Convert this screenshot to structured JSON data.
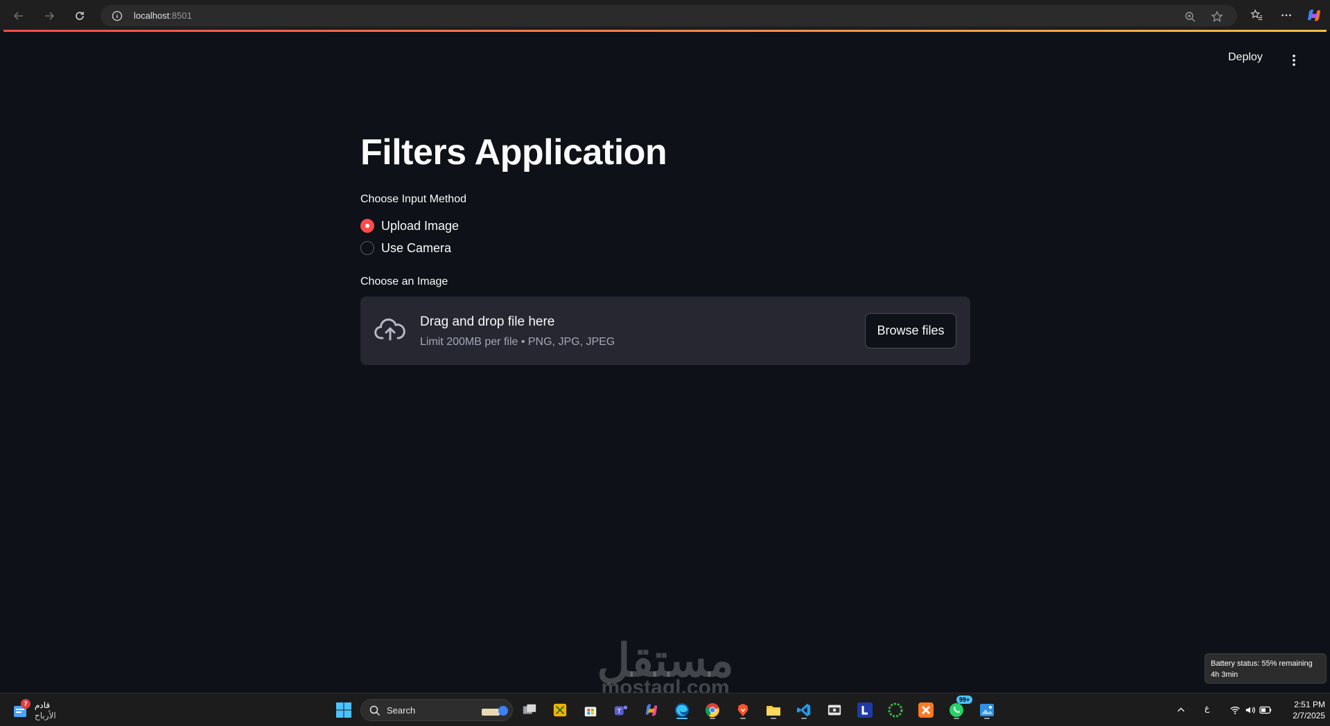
{
  "browser": {
    "url_host": "localhost",
    "url_port": ":8501"
  },
  "header": {
    "deploy_label": "Deploy"
  },
  "main": {
    "title": "Filters Application",
    "input_method_label": "Choose Input Method",
    "radio_options": [
      {
        "label": "Upload Image",
        "selected": true
      },
      {
        "label": "Use Camera",
        "selected": false
      }
    ],
    "uploader": {
      "label": "Choose an Image",
      "drop_text": "Drag and drop file here",
      "limit_text": "Limit 200MB per file • PNG, JPG, JPEG",
      "browse_label": "Browse files"
    }
  },
  "watermark": {
    "arabic": "مستقل",
    "latin": "mostaql.com"
  },
  "tooltip": {
    "battery_line1": "Battery status: 55% remaining",
    "battery_line2": "4h 3min"
  },
  "taskbar": {
    "weather_badge": "7",
    "weather_line1": "قادم",
    "weather_line2": "الأرباح",
    "search_placeholder": "Search",
    "whatsapp_badge": "99+",
    "lang_indicator": "ع",
    "time": "2:51 PM",
    "date": "2/7/2025"
  },
  "colors": {
    "accent": "#ff4b4b",
    "background": "#0e1117",
    "uploader_bg": "#262730"
  }
}
